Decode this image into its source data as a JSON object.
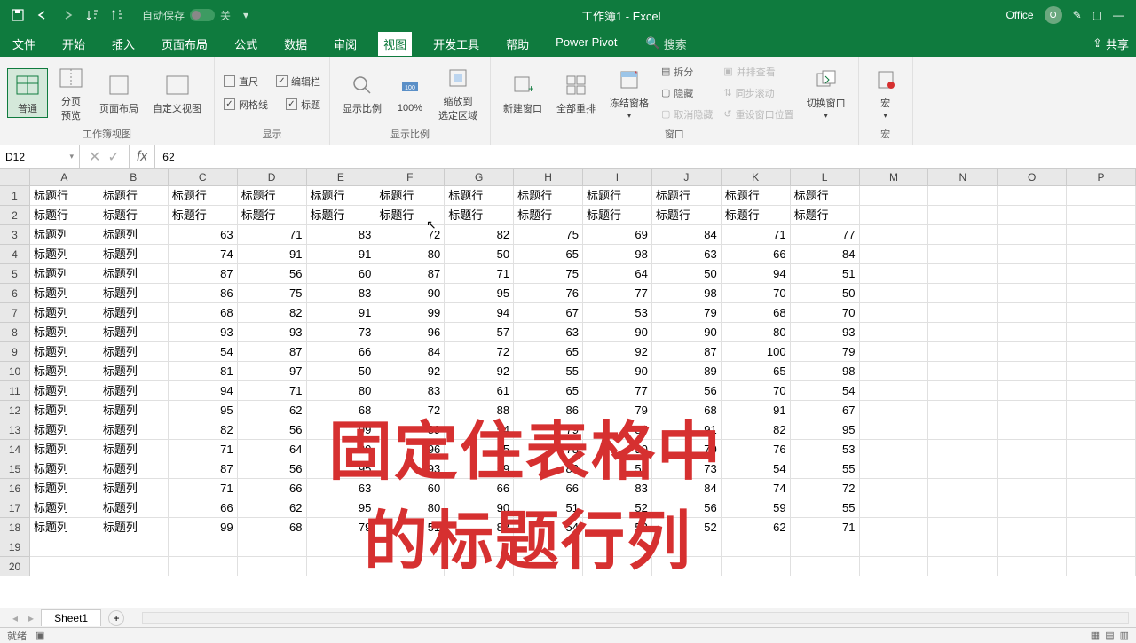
{
  "titlebar": {
    "autosave_label": "自动保存",
    "autosave_state": "关",
    "title": "工作簿1 - Excel",
    "office_label": "Office",
    "avatar_letter": "O"
  },
  "menu": {
    "items": [
      "文件",
      "开始",
      "插入",
      "页面布局",
      "公式",
      "数据",
      "审阅",
      "视图",
      "开发工具",
      "帮助",
      "Power Pivot"
    ],
    "active_index": 7,
    "search_label": "搜索",
    "share_label": "共享"
  },
  "ribbon": {
    "group_view": {
      "label": "工作簿视图",
      "normal": "普通",
      "page_preview": "分页\n预览",
      "page_layout": "页面布局",
      "custom": "自定义视图"
    },
    "group_show": {
      "label": "显示",
      "ruler": "直尺",
      "formula_bar": "编辑栏",
      "gridlines": "网格线",
      "headings": "标题"
    },
    "group_zoom": {
      "label": "显示比例",
      "zoom": "显示比例",
      "hundred": "100%",
      "selection": "缩放到\n选定区域"
    },
    "group_window": {
      "label": "窗口",
      "new": "新建窗口",
      "arrange": "全部重排",
      "freeze": "冻结窗格",
      "split": "拆分",
      "hide": "隐藏",
      "unhide": "取消隐藏",
      "side": "并排查看",
      "sync": "同步滚动",
      "reset": "重设窗口位置",
      "switch": "切换窗口"
    },
    "group_macro": {
      "label": "宏",
      "macro": "宏"
    }
  },
  "formula_bar": {
    "cell_ref": "D12",
    "value": "62"
  },
  "columns": [
    "A",
    "B",
    "C",
    "D",
    "E",
    "F",
    "G",
    "H",
    "I",
    "J",
    "K",
    "L",
    "M",
    "N",
    "O",
    "P"
  ],
  "row_numbers": [
    "1",
    "2",
    "3",
    "4",
    "5",
    "6",
    "7",
    "8",
    "9",
    "10",
    "11",
    "12",
    "13",
    "14",
    "15",
    "16",
    "17",
    "18",
    "19",
    "20"
  ],
  "header_row": [
    "标题行",
    "标题行",
    "标题行",
    "标题行",
    "标题行",
    "标题行",
    "标题行",
    "标题行",
    "标题行",
    "标题行",
    "标题行",
    "标题行"
  ],
  "data_rows": [
    [
      "标题列",
      "标题列",
      "63",
      "71",
      "83",
      "72",
      "82",
      "75",
      "69",
      "84",
      "71",
      "77"
    ],
    [
      "标题列",
      "标题列",
      "74",
      "91",
      "91",
      "80",
      "50",
      "65",
      "98",
      "63",
      "66",
      "84"
    ],
    [
      "标题列",
      "标题列",
      "87",
      "56",
      "60",
      "87",
      "71",
      "75",
      "64",
      "50",
      "94",
      "51"
    ],
    [
      "标题列",
      "标题列",
      "86",
      "75",
      "83",
      "90",
      "95",
      "76",
      "77",
      "98",
      "70",
      "50"
    ],
    [
      "标题列",
      "标题列",
      "68",
      "82",
      "91",
      "99",
      "94",
      "67",
      "53",
      "79",
      "68",
      "70"
    ],
    [
      "标题列",
      "标题列",
      "93",
      "93",
      "73",
      "96",
      "57",
      "63",
      "90",
      "90",
      "80",
      "93"
    ],
    [
      "标题列",
      "标题列",
      "54",
      "87",
      "66",
      "84",
      "72",
      "65",
      "92",
      "87",
      "100",
      "79"
    ],
    [
      "标题列",
      "标题列",
      "81",
      "97",
      "50",
      "92",
      "92",
      "55",
      "90",
      "89",
      "65",
      "98"
    ],
    [
      "标题列",
      "标题列",
      "94",
      "71",
      "80",
      "83",
      "61",
      "65",
      "77",
      "56",
      "70",
      "54"
    ],
    [
      "标题列",
      "标题列",
      "95",
      "62",
      "68",
      "72",
      "88",
      "86",
      "79",
      "68",
      "91",
      "67"
    ],
    [
      "标题列",
      "标题列",
      "82",
      "56",
      "99",
      "89",
      "54",
      "79",
      "85",
      "91",
      "82",
      "95"
    ],
    [
      "标题列",
      "标题列",
      "71",
      "64",
      "80",
      "96",
      "55",
      "78",
      "90",
      "70",
      "76",
      "53"
    ],
    [
      "标题列",
      "标题列",
      "87",
      "56",
      "95",
      "93",
      "59",
      "80",
      "53",
      "73",
      "54",
      "55"
    ],
    [
      "标题列",
      "标题列",
      "71",
      "66",
      "63",
      "60",
      "66",
      "66",
      "83",
      "84",
      "74",
      "72"
    ],
    [
      "标题列",
      "标题列",
      "66",
      "62",
      "95",
      "80",
      "90",
      "51",
      "52",
      "56",
      "59",
      "55"
    ],
    [
      "标题列",
      "标题列",
      "99",
      "68",
      "79",
      "51",
      "83",
      "54",
      "53",
      "52",
      "62",
      "71"
    ]
  ],
  "overlay": {
    "line1": "固定住表格中",
    "line2": "的标题行列"
  },
  "sheets": {
    "active": "Sheet1"
  },
  "status": {
    "ready": "就绪"
  }
}
